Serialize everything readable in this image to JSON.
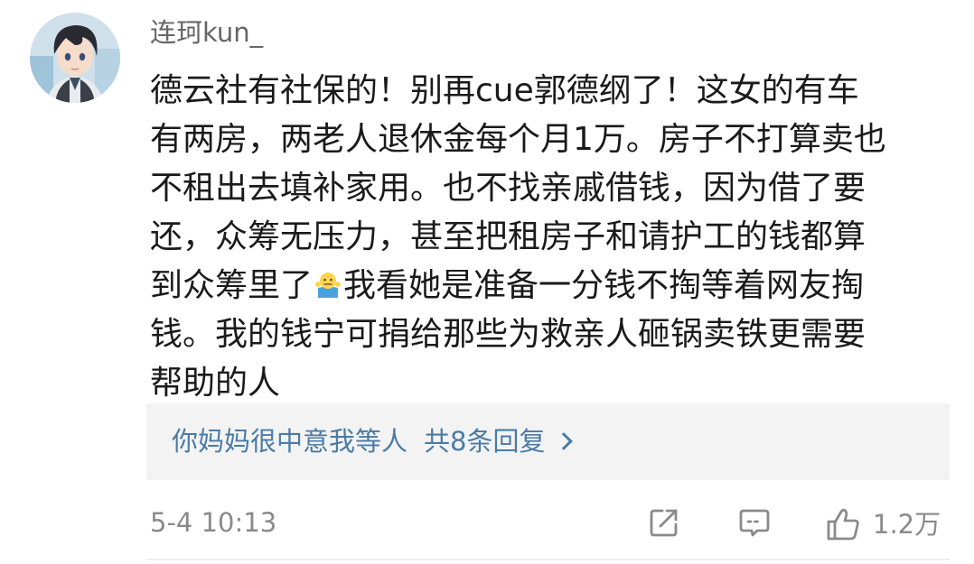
{
  "comment": {
    "username": "连珂kun_",
    "text_part1": "德云社有社保的！别再cue郭德纲了！这女的有车\n有两房，两老人退休金每个月1万。房子不打算卖也\n不租出去填补家用。也不找亲戚借钱，因为借了要\n还，众筹无压力，甚至把租房子和请护工的钱都算\n到众筹里了",
    "emoji": "shrug-emoji",
    "text_part2": "我看她是准备一分钱不掏等着网友掏\n钱。我的钱宁可捐给那些为救亲人砸锅卖铁更需要\n帮助的人",
    "time": "5-4 10:13",
    "like_count": "1.2万"
  },
  "replies": {
    "text": "你妈妈很中意我等人",
    "count_label": "共8条回复"
  },
  "icons": {
    "share": "share-icon",
    "comment": "comment-icon",
    "like": "thumbs-up-icon"
  },
  "colors": {
    "link": "#4a7ba6",
    "username": "#666666",
    "body": "#1a1a1a",
    "meta": "#8a8a8a",
    "reply_bg": "#f3f3f3"
  }
}
